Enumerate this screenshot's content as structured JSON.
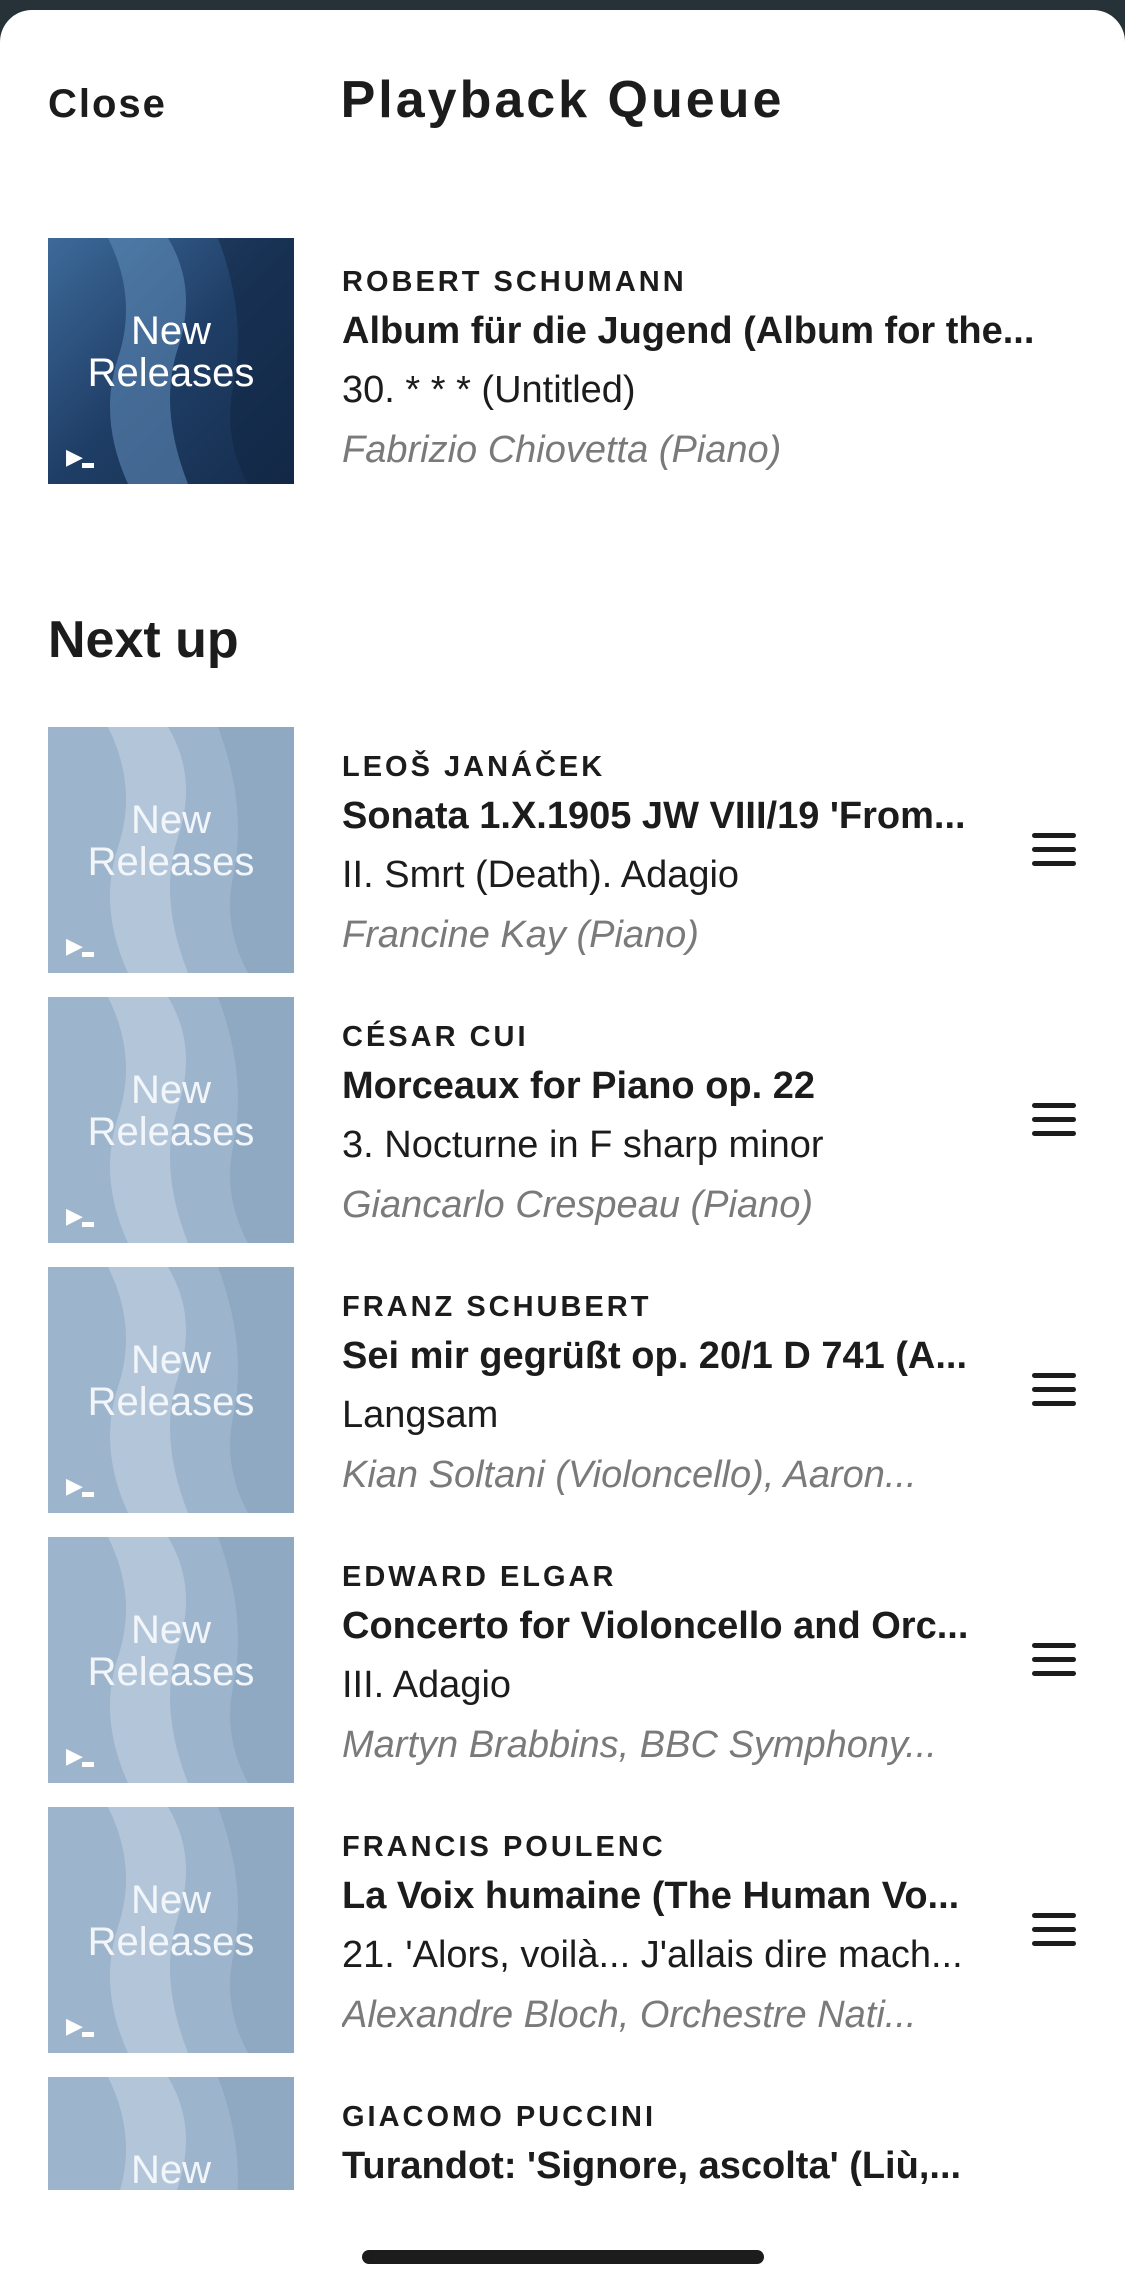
{
  "header": {
    "close_label": "Close",
    "title": "Playback Queue"
  },
  "cover_text": {
    "line1": "New",
    "line2": "Releases"
  },
  "now_playing": {
    "composer": "ROBERT SCHUMANN",
    "work": "Album für die Jugend (Album for the...",
    "movement": "30. * * * (Untitled)",
    "performers": "Fabrizio Chiovetta (Piano)"
  },
  "next_up": {
    "title": "Next up",
    "items": [
      {
        "composer": "LEOŠ JANÁČEK",
        "work": "Sonata 1.X.1905 JW VIII/19 'From...",
        "movement": "II. Smrt (Death). Adagio",
        "performers": "Francine Kay (Piano)"
      },
      {
        "composer": "CÉSAR CUI",
        "work": "Morceaux for Piano op. 22",
        "movement": "3. Nocturne in F sharp minor",
        "performers": "Giancarlo Crespeau (Piano)"
      },
      {
        "composer": "FRANZ SCHUBERT",
        "work": "Sei mir gegrüßt op. 20/1 D 741 (A...",
        "movement": "Langsam",
        "performers": "Kian Soltani (Violoncello), Aaron..."
      },
      {
        "composer": "EDWARD ELGAR",
        "work": "Concerto for Violoncello and Orc...",
        "movement": "III. Adagio",
        "performers": "Martyn Brabbins, BBC Symphony..."
      },
      {
        "composer": "FRANCIS POULENC",
        "work": "La Voix humaine (The Human Vo...",
        "movement": "21. 'Alors, voilà... J'allais dire mach...",
        "performers": "Alexandre Bloch, Orchestre Nati..."
      },
      {
        "composer": "GIACOMO PUCCINI",
        "work": "Turandot: 'Signore, ascolta' (Liù,...",
        "movement": "",
        "performers": ""
      }
    ]
  },
  "colors": {
    "cover_dark": "#1f3e66",
    "cover_light": "#9cb4cc",
    "text": "#1c1c1c",
    "muted": "#7a7a7a"
  }
}
